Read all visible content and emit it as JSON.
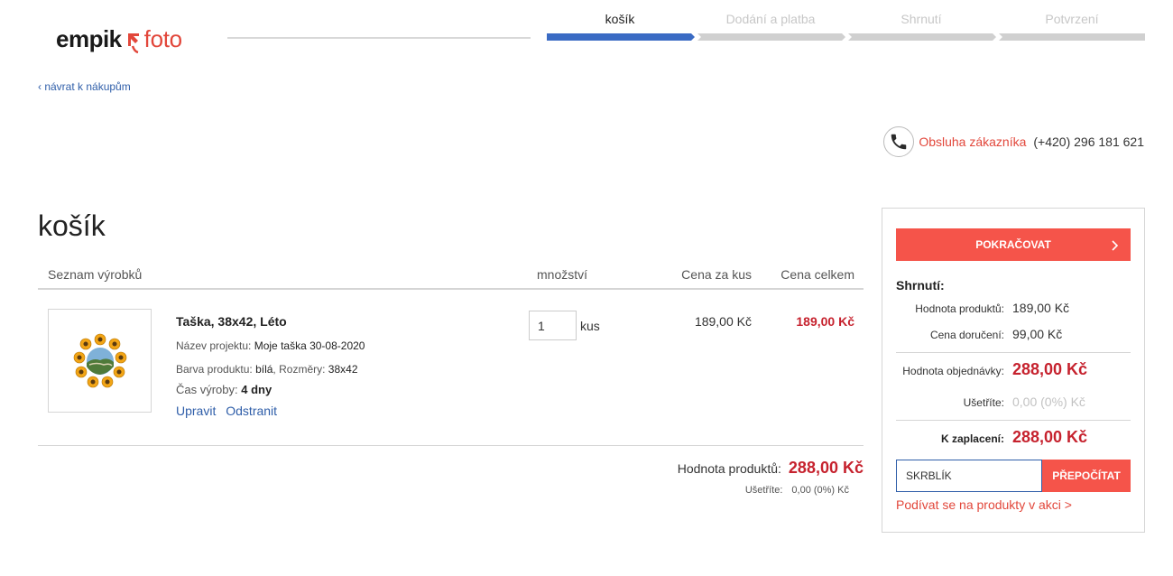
{
  "header": {
    "logo_left": "empik",
    "logo_right": "foto",
    "logo_icon": "empik-foto-logo-mark",
    "steps": [
      {
        "label": "košík",
        "active": true
      },
      {
        "label": "Dodání a platba",
        "active": false
      },
      {
        "label": "Shrnutí",
        "active": false
      },
      {
        "label": "Potvrzení",
        "active": false
      }
    ]
  },
  "back_link": "‹ návrat k nákupům",
  "contact": {
    "icon": "phone-icon",
    "label": "Obsluha zákazníka",
    "phone": "(+420) 296 181 621"
  },
  "page_title": "košík",
  "cart": {
    "columns": {
      "products": "Seznam výrobků",
      "quantity": "množství",
      "unit_price": "Cena za kus",
      "total_price": "Cena celkem"
    },
    "items": [
      {
        "name": "Taška, 38x42, Léto",
        "project_label": "Název projektu:",
        "project_value": "Moje taška 30-08-2020",
        "color_label": "Barva produktu:",
        "color_value": "bílá",
        "size_label": "Rozměry:",
        "size_value": "38x42",
        "time_label": "Čas výroby:",
        "time_value": "4 dny",
        "edit_label": "Upravit",
        "remove_label": "Odstranit",
        "quantity": "1",
        "quantity_unit": "kus",
        "unit_price": "189,00 Kč",
        "total_price": "189,00 Kč"
      }
    ],
    "totals": {
      "label": "Hodnota produktů:",
      "value": "288,00 Kč",
      "savings_label": "Ušetříte:",
      "savings_value": "0,00 (0%) Kč"
    }
  },
  "summary": {
    "continue_label": "POKRAČOVAT",
    "title": "Shrnutí:",
    "products_label": "Hodnota produktů:",
    "products_value": "189,00 Kč",
    "delivery_label": "Cena doručení:",
    "delivery_value": "99,00 Kč",
    "order_label": "Hodnota objednávky:",
    "order_value": "288,00 Kč",
    "savings_label": "Ušetříte:",
    "savings_value": "0,00 (0%) Kč",
    "pay_label": "K zaplacení:",
    "pay_value": "288,00 Kč",
    "promo_value": "SKRBLÍK",
    "recalc_label": "PŘEPOČÍTAT",
    "promo_link": "Podívat se na produkty v akci >"
  },
  "colors": {
    "accent_red": "#f5544a",
    "price_red": "#c6222e",
    "link_blue": "#2f5ea9",
    "step_active": "#3a6bc4",
    "step_inactive": "#d0d0d0"
  }
}
